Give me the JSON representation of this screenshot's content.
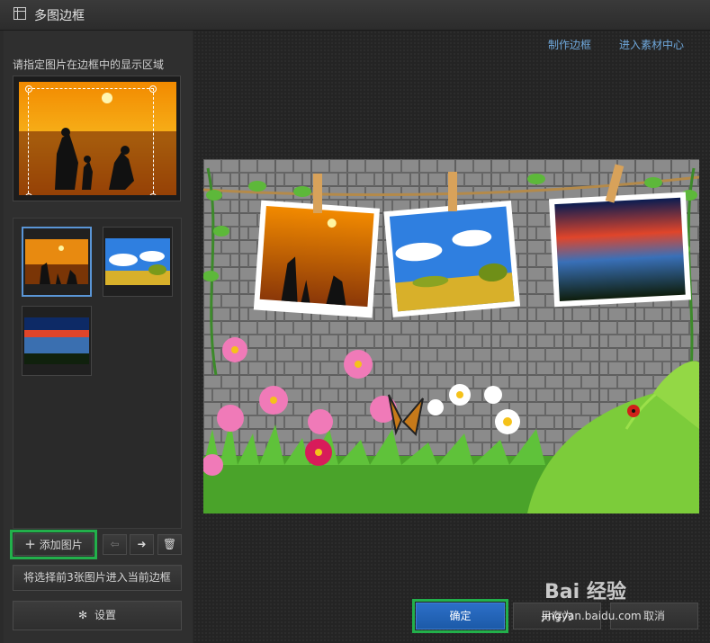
{
  "window": {
    "title": "多图边框"
  },
  "left_panel": {
    "hint": "请指定图片在边框中的显示区域",
    "add_button_label": "添加图片",
    "apply_button_label": "将选择前3张图片进入当前边框",
    "settings_button_label": "设置"
  },
  "thumbnails": [
    {
      "name": "beach-sunset-family",
      "selected": true
    },
    {
      "name": "blue-sky-trees",
      "selected": false
    },
    {
      "name": "lake-sunset",
      "selected": false
    }
  ],
  "main_panel": {
    "make_frame_link": "制作边框",
    "material_center_link": "进入素材中心"
  },
  "footer": {
    "ok_label": "确定",
    "save_as_label": "另存为",
    "cancel_label": "取消"
  },
  "watermark": {
    "brand": "Bai 经验",
    "url": "jingyan.baidu.com"
  },
  "colors": {
    "accent_link": "#6fa8dc",
    "highlight": "#22b04b",
    "selected_border": "#5a95d6"
  }
}
